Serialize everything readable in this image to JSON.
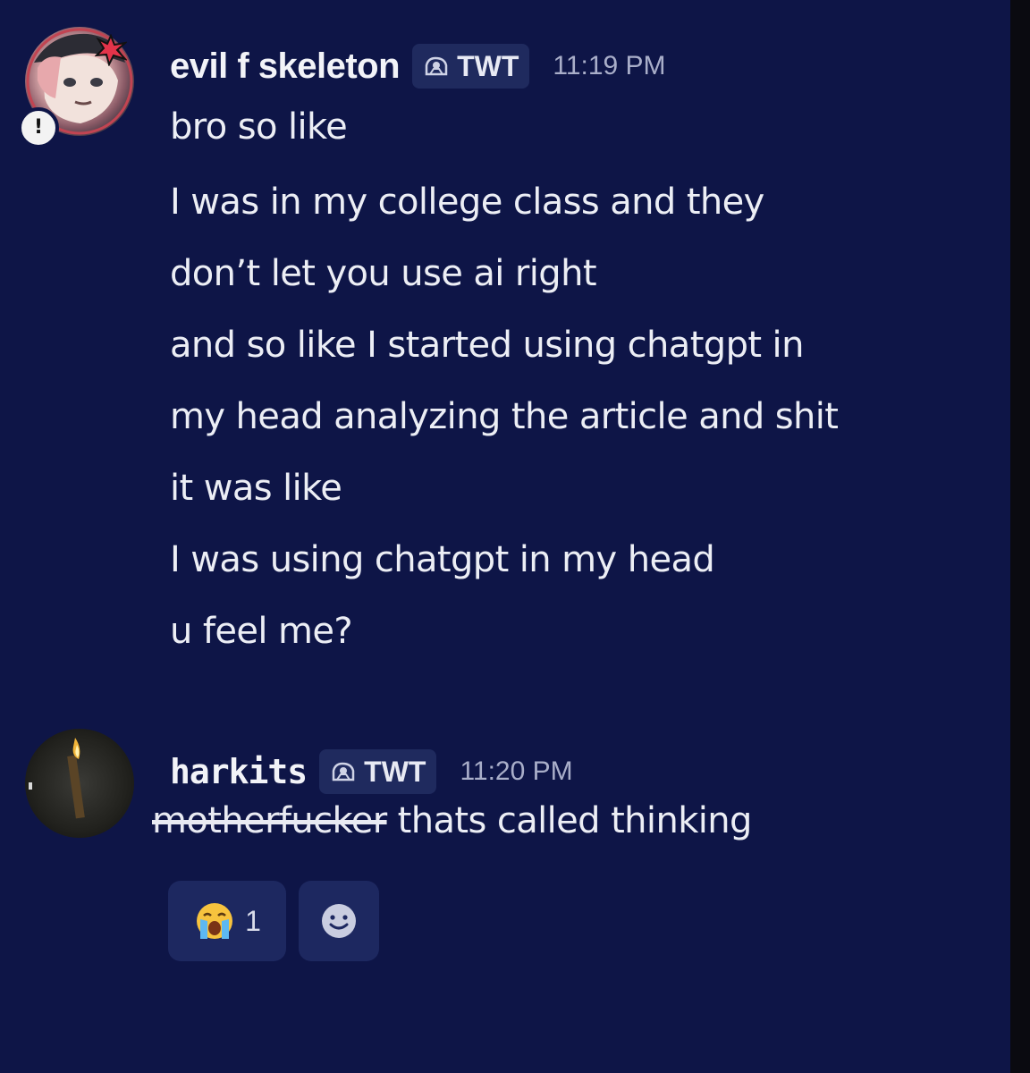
{
  "messages": [
    {
      "username": "evil f skeleton",
      "tag": "TWT",
      "time": "11:19 PM",
      "avatar_badge": "!",
      "lines": [
        "bro so like",
        "I was in my college class and they",
        "don’t let you use ai right",
        "and so like I started using chatgpt in",
        "my head analyzing the article and shit",
        "it was like",
        "I was using chatgpt in my head",
        "u feel me?"
      ]
    },
    {
      "username": "harkits",
      "tag": "TWT",
      "time": "11:20 PM",
      "struck_text": "motherfucker",
      "text": " thats called thinking",
      "reactions": [
        {
          "icon": "loudly-crying-face-icon",
          "count": "1"
        },
        {
          "icon": "add-reaction-icon"
        }
      ]
    }
  ],
  "colors": {
    "background": "#0e1547",
    "tag_background": "#1f2a5e",
    "reaction_background": "#1d2860",
    "timestamp": "#a9aec9"
  }
}
